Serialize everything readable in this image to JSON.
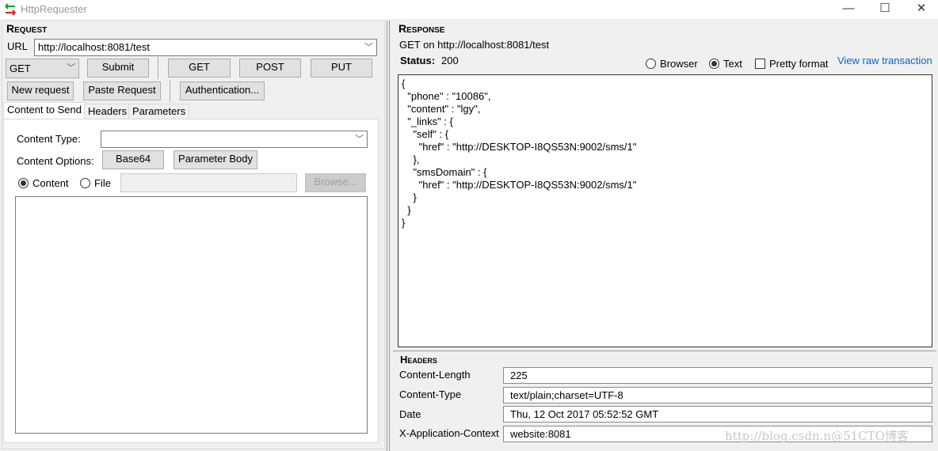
{
  "window": {
    "title": "HttpRequester",
    "minimize": "—",
    "maximize": "☐",
    "close": "✕"
  },
  "request": {
    "section": "Request",
    "url_label": "URL",
    "url_value": "http://localhost:8081/test",
    "method_value": "GET",
    "submit": "Submit",
    "get": "GET",
    "post": "POST",
    "put": "PUT",
    "new_request": "New request",
    "paste_request": "Paste Request",
    "authentication": "Authentication...",
    "tabs": [
      {
        "label": "Content to Send"
      },
      {
        "label": "Headers"
      },
      {
        "label": "Parameters"
      }
    ],
    "content_type_label": "Content Type:",
    "content_type_value": "",
    "content_options_label": "Content Options:",
    "base64": "Base64",
    "parameter_body": "Parameter Body",
    "radio_content": "Content",
    "radio_file": "File",
    "file_path": "",
    "browse": "Browse...",
    "content_body": ""
  },
  "response": {
    "section": "Response",
    "summary": "GET on http://localhost:8081/test",
    "status_label": "Status:",
    "status_value": "200",
    "view_browser": "Browser",
    "view_text": "Text",
    "view_selected": "Text",
    "pretty_format": "Pretty format",
    "pretty_checked": false,
    "view_raw": "View raw transaction",
    "link_color": "#0066cc",
    "body": "{\n  \"phone\" : \"10086\",\n  \"content\" : \"lgy\",\n  \"_links\" : {\n    \"self\" : {\n      \"href\" : \"http://DESKTOP-I8QS53N:9002/sms/1\"\n    },\n    \"smsDomain\" : {\n      \"href\" : \"http://DESKTOP-I8QS53N:9002/sms/1\"\n    }\n  }\n}",
    "headers_section": "Headers",
    "headers": [
      {
        "name": "Content-Length",
        "value": "225"
      },
      {
        "name": "Content-Type",
        "value": "text/plain;charset=UTF-8"
      },
      {
        "name": "Date",
        "value": "Thu, 12 Oct 2017 05:52:52 GMT"
      },
      {
        "name": "X-Application-Context",
        "value": "website:8081"
      }
    ]
  },
  "watermark": "http://blog.csdn.n@51CTO博客"
}
